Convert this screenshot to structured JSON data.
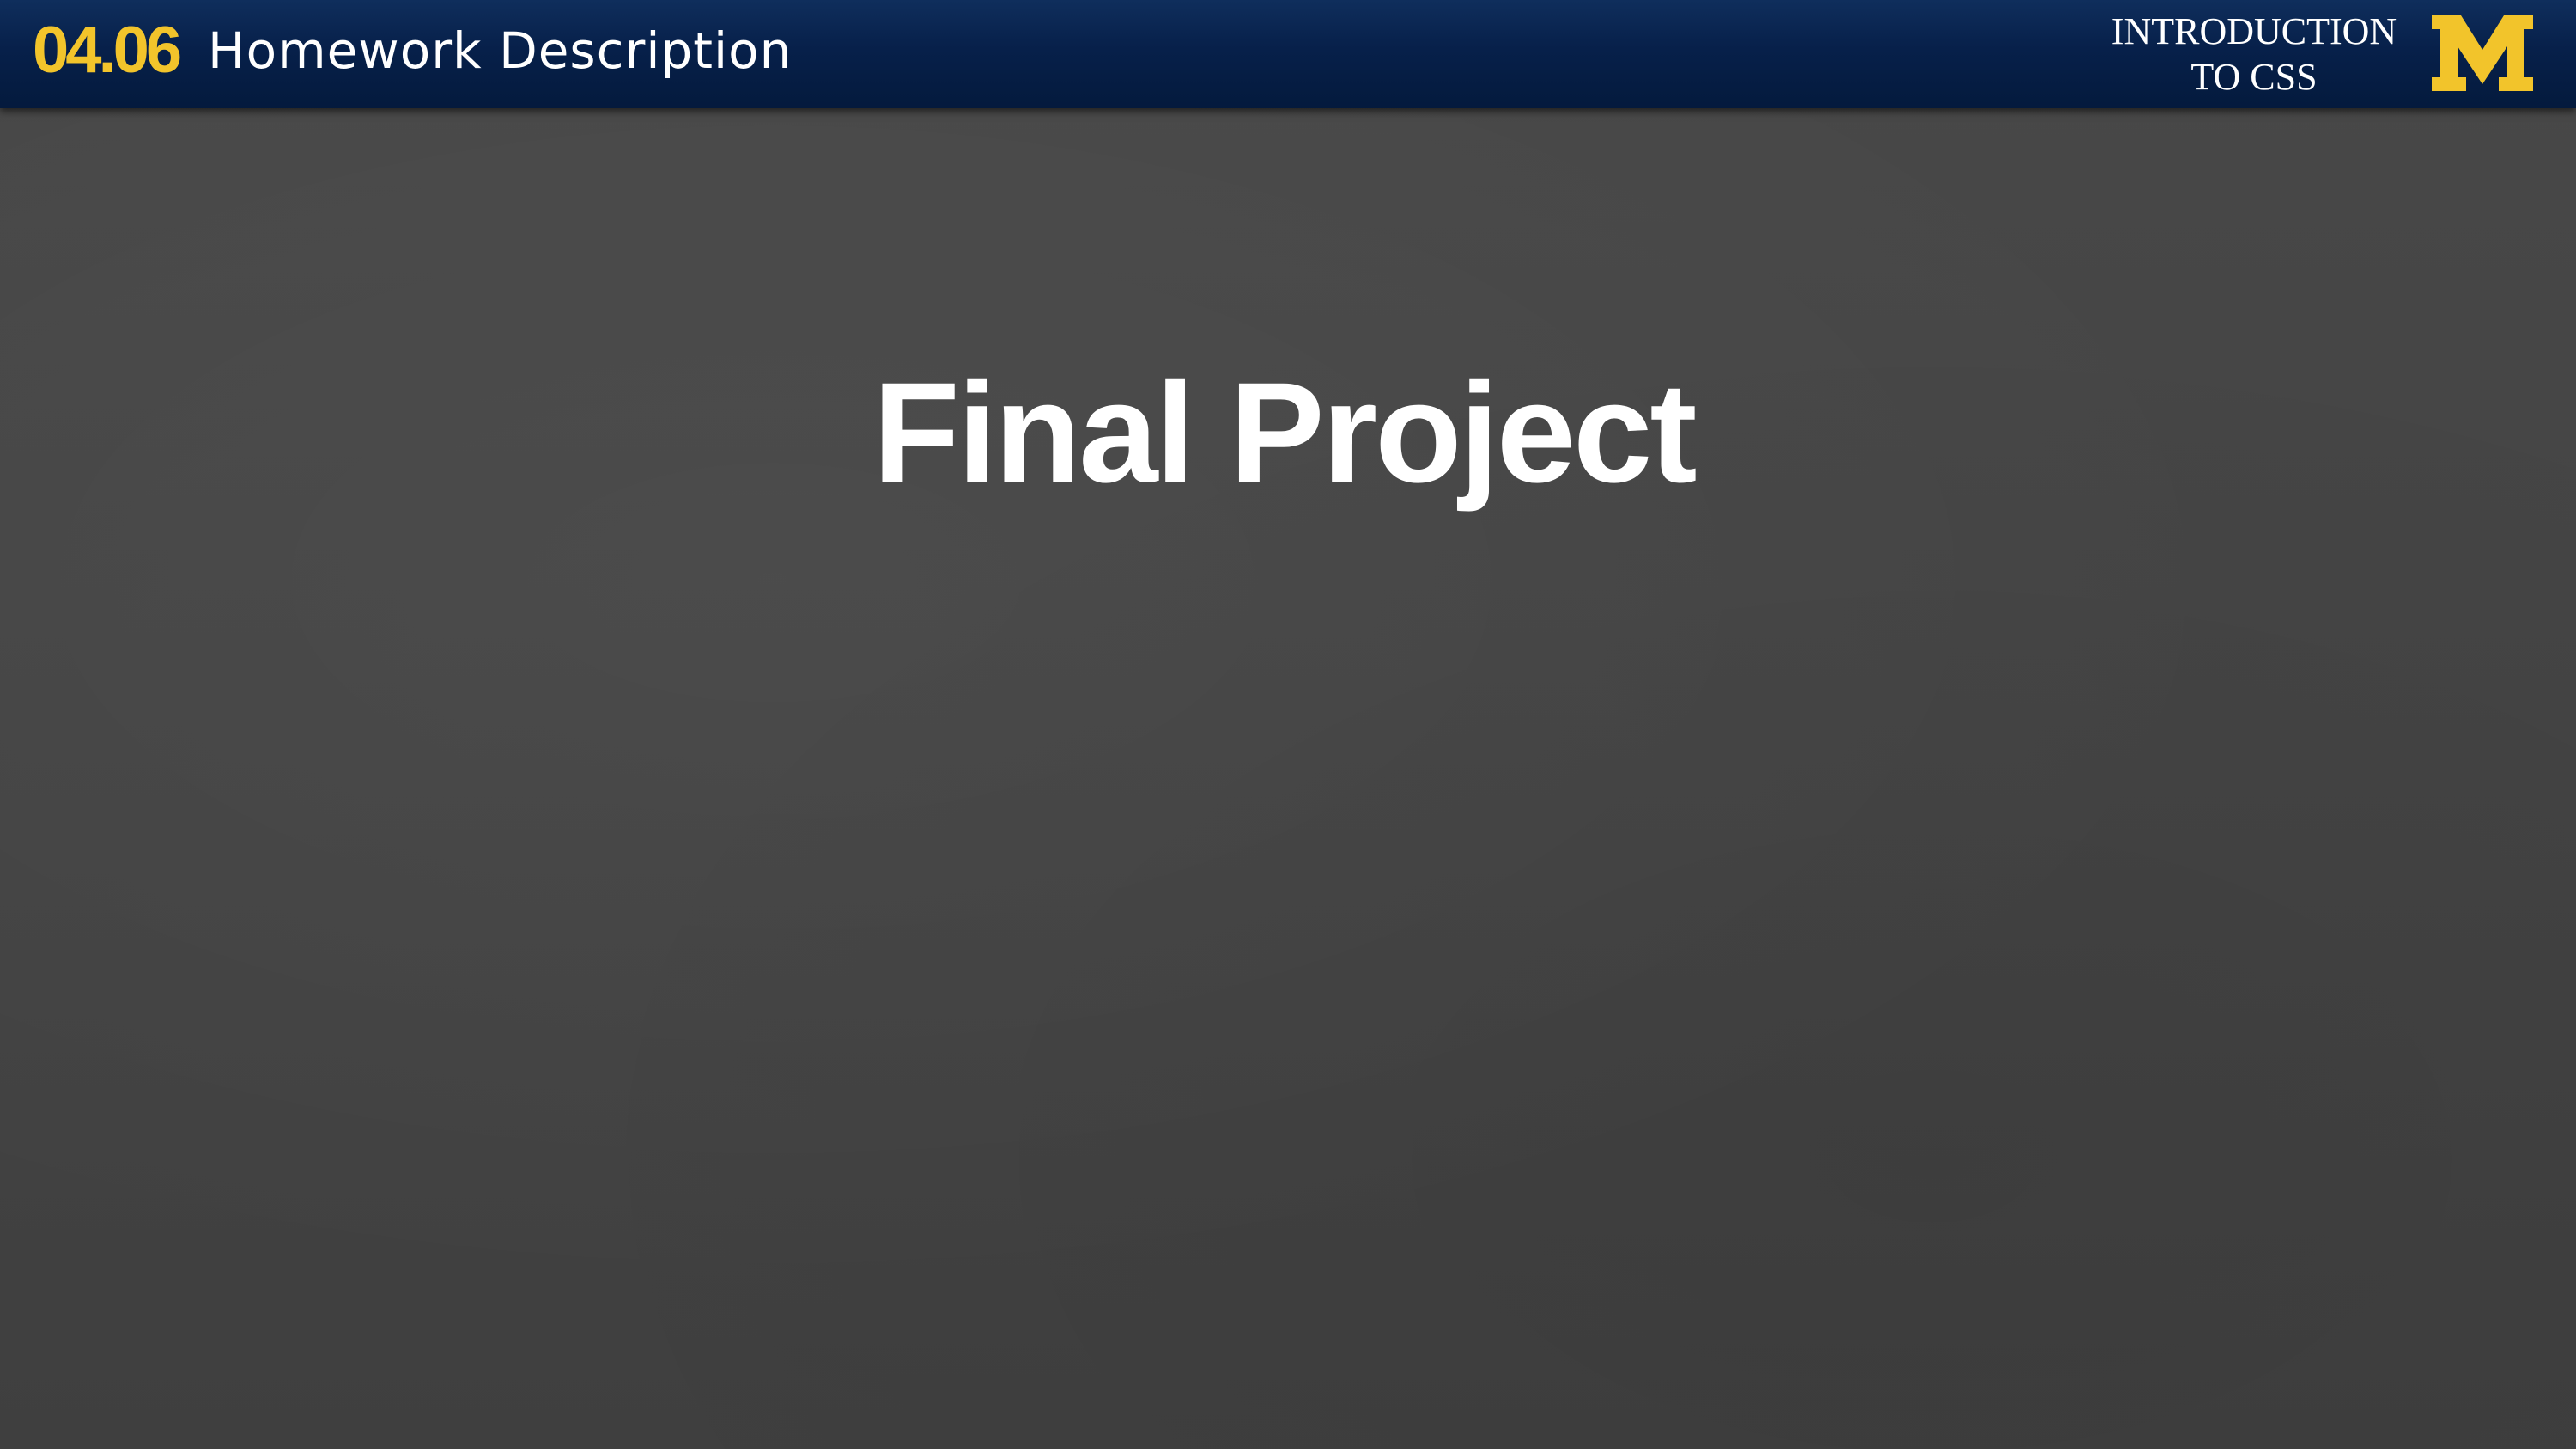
{
  "header": {
    "lesson_number": "04.06",
    "lesson_title": "Homework Description",
    "course_title_line1": "INTRODUCTION",
    "course_title_line2": "TO CSS",
    "logo_icon": "block-m-icon",
    "logo_letter": "M"
  },
  "slide": {
    "title": "Final Project"
  },
  "colors": {
    "header_bg": "#07204a",
    "accent_maize": "#f2c42b",
    "background": "#444444",
    "text": "#ffffff"
  }
}
